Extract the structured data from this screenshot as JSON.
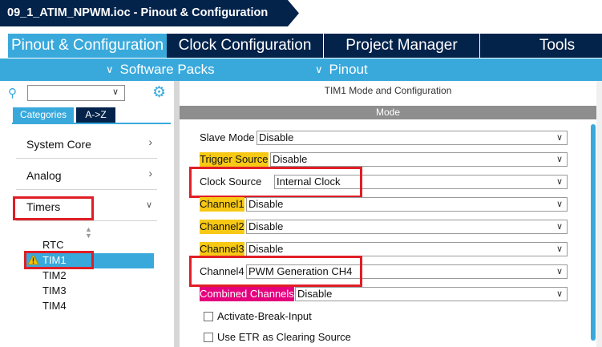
{
  "window": {
    "title": "09_1_ATIM_NPWM.ioc - Pinout & Configuration"
  },
  "main_tabs": [
    {
      "label": "Pinout & Configuration"
    },
    {
      "label": "Clock Configuration"
    },
    {
      "label": "Project Manager"
    },
    {
      "label": "Tools"
    }
  ],
  "sub_tabs": [
    {
      "label": "Software Packs",
      "icon": "chevron-down-icon"
    },
    {
      "label": "Pinout",
      "icon": "chevron-down-icon"
    }
  ],
  "sidebar": {
    "search": {
      "value": "",
      "icon": "search-icon"
    },
    "settings_icon": "gear-icon",
    "view_tabs": [
      {
        "label": "Categories"
      },
      {
        "label": "A->Z"
      }
    ],
    "categories": [
      {
        "label": "System Core"
      },
      {
        "label": "Analog"
      },
      {
        "label": "Timers"
      }
    ],
    "timers": [
      {
        "label": "RTC"
      },
      {
        "label": "TIM1",
        "selected": true,
        "icon": "warning-icon"
      },
      {
        "label": "TIM2"
      },
      {
        "label": "TIM3"
      },
      {
        "label": "TIM4"
      }
    ]
  },
  "panel": {
    "title": "TIM1 Mode and Configuration",
    "section": "Mode",
    "fields": [
      {
        "label": "Slave Mode",
        "value": "Disable"
      },
      {
        "label": "Trigger Source",
        "value": "Disable",
        "highlight": "#f7c915"
      },
      {
        "label": "Clock Source",
        "value": "Internal Clock"
      },
      {
        "label": "Channel1",
        "value": "Disable",
        "highlight": "#f7c915"
      },
      {
        "label": "Channel2",
        "value": "Disable",
        "highlight": "#f7c915"
      },
      {
        "label": "Channel3",
        "value": "Disable",
        "highlight": "#f7c915"
      },
      {
        "label": "Channel4",
        "value": "PWM Generation CH4"
      },
      {
        "label": "Combined Channels",
        "value": "Disable",
        "highlight": "#e5007d"
      }
    ],
    "checkboxes": [
      {
        "label": "Activate-Break-Input",
        "checked": false
      },
      {
        "label": "Use ETR as Clearing Source",
        "checked": false
      }
    ]
  },
  "colors": {
    "navy": "#03234b",
    "accent": "#39a9dc",
    "annotation_red": "#e01e26"
  }
}
